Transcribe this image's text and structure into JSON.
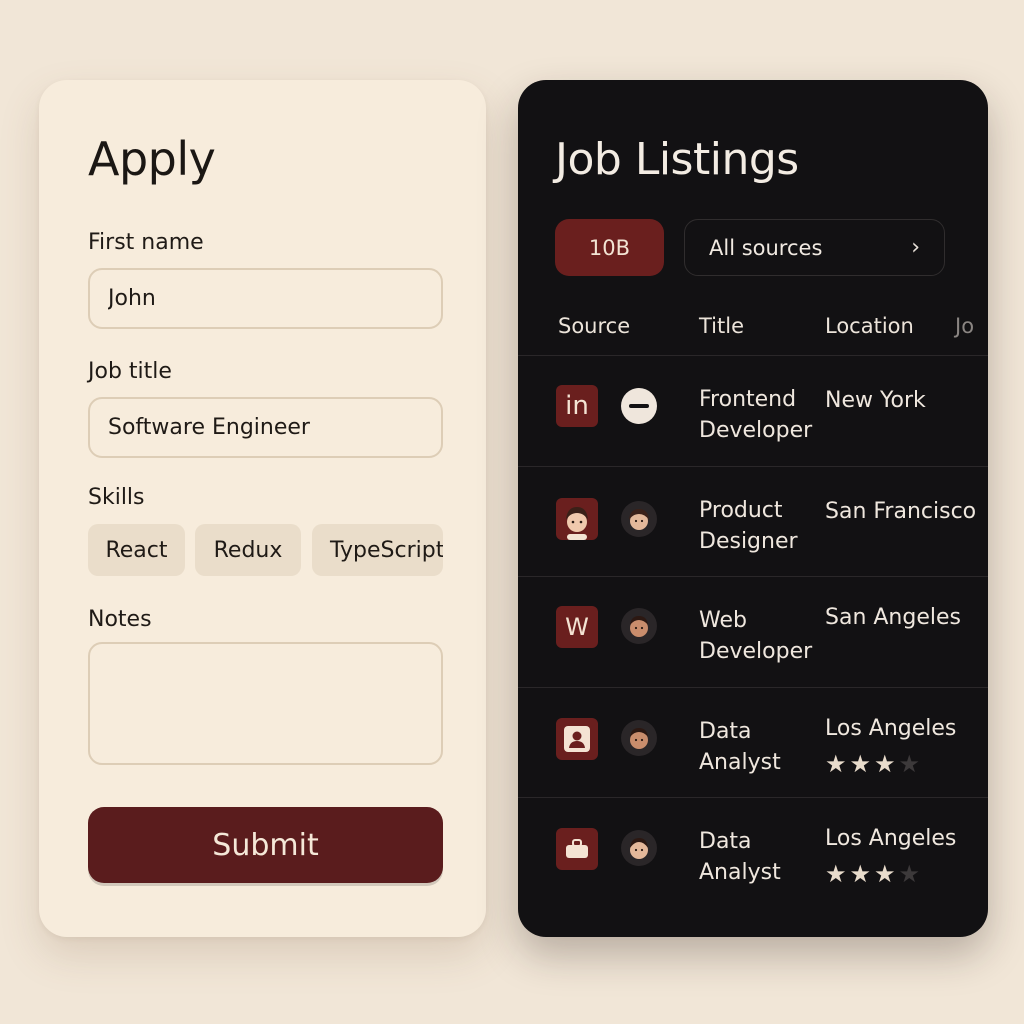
{
  "apply": {
    "title": "Apply",
    "first_name_label": "First name",
    "first_name_value": "John",
    "job_title_label": "Job title",
    "job_title_value": "Software Engineer",
    "skills_label": "Skills",
    "skills": [
      "React",
      "Redux",
      "TypeScript"
    ],
    "notes_label": "Notes",
    "notes_value": "",
    "submit_label": "Submit"
  },
  "jobs": {
    "title": "Job Listings",
    "count_label": "10B",
    "source_filter": "All sources",
    "columns": [
      "Source",
      "Title",
      "Location",
      "Jo"
    ],
    "rows": [
      {
        "source_icon": "linkedin-icon",
        "source_text": "in",
        "avatar": "minus-circle-icon",
        "title_line1": "Frontend",
        "title_line2": "Developer",
        "location": "New York",
        "rating": null
      },
      {
        "source_icon": "person-avatar-icon",
        "source_text": "",
        "avatar": "person-avatar-icon",
        "title_line1": "Product",
        "title_line2": "Designer",
        "location": "San Francisco",
        "rating": null
      },
      {
        "source_icon": "w-logo-icon",
        "source_text": "W",
        "avatar": "person-avatar-icon",
        "title_line1": "Web",
        "title_line2": "Developer",
        "location": "San Angeles",
        "rating": null
      },
      {
        "source_icon": "user-badge-icon",
        "source_text": "",
        "avatar": "person-avatar-icon",
        "title_line1": "Data",
        "title_line2": "Analyst",
        "location": "Los Angeles",
        "rating": 3,
        "rating_max": 4
      },
      {
        "source_icon": "briefcase-icon",
        "source_text": "",
        "avatar": "person-avatar-icon",
        "title_line1": "Data",
        "title_line2": "Analyst",
        "location": "Los Angeles",
        "rating": 3,
        "rating_max": 4
      }
    ]
  },
  "colors": {
    "accent": "#5a1c1d",
    "page_bg": "#f1e6d7",
    "card_light": "#f7ecdc",
    "card_dark": "#121113"
  }
}
